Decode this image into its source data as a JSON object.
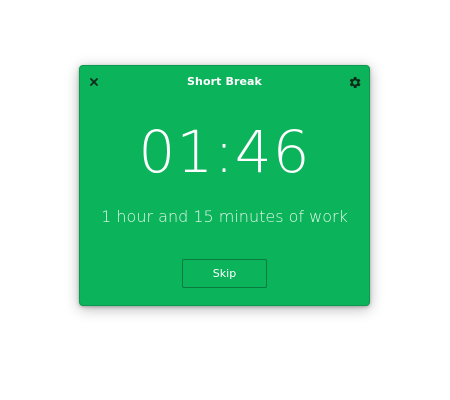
{
  "window": {
    "title": "Short Break",
    "timer": "01:46",
    "subtitle": "1 hour and 15 minutes of work",
    "skip_label": "Skip",
    "close_icon": "close-icon",
    "settings_icon": "gear-icon"
  },
  "colors": {
    "background": "#0bb35a",
    "text": "#ffffff",
    "icon": "#0d2a1a",
    "button_border": "#0a7a3e"
  }
}
